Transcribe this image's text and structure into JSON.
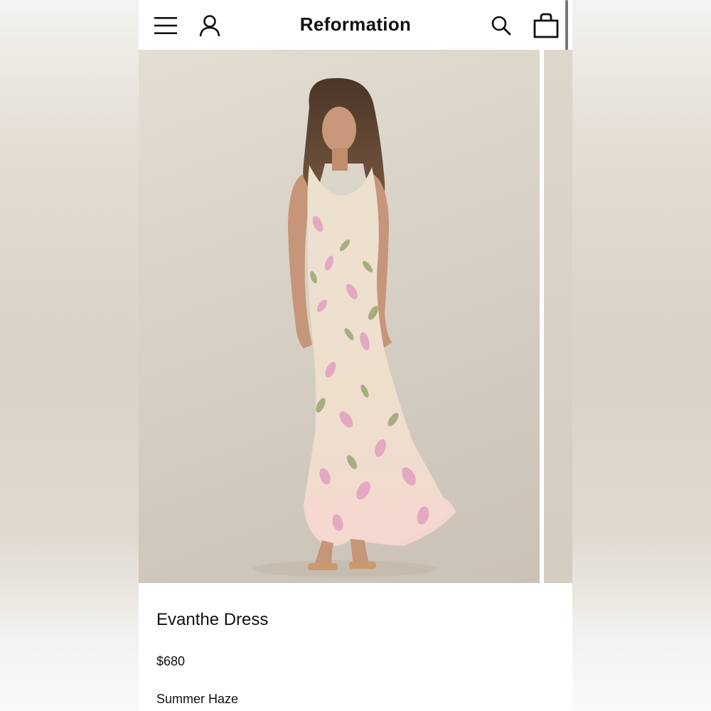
{
  "header": {
    "brand": "Reformation",
    "icons": [
      "menu-icon",
      "account-icon",
      "search-icon",
      "bag-icon"
    ]
  },
  "product": {
    "name": "Evanthe Dress",
    "price": "$680",
    "color": "Summer Haze"
  },
  "colors": {
    "background": "#ffffff",
    "text": "#111111",
    "photo_backdrop": "#d9d2c6",
    "dress_base": "#efe2cf",
    "floral_pink": "#e6a6c2",
    "floral_green": "#93a06a"
  }
}
